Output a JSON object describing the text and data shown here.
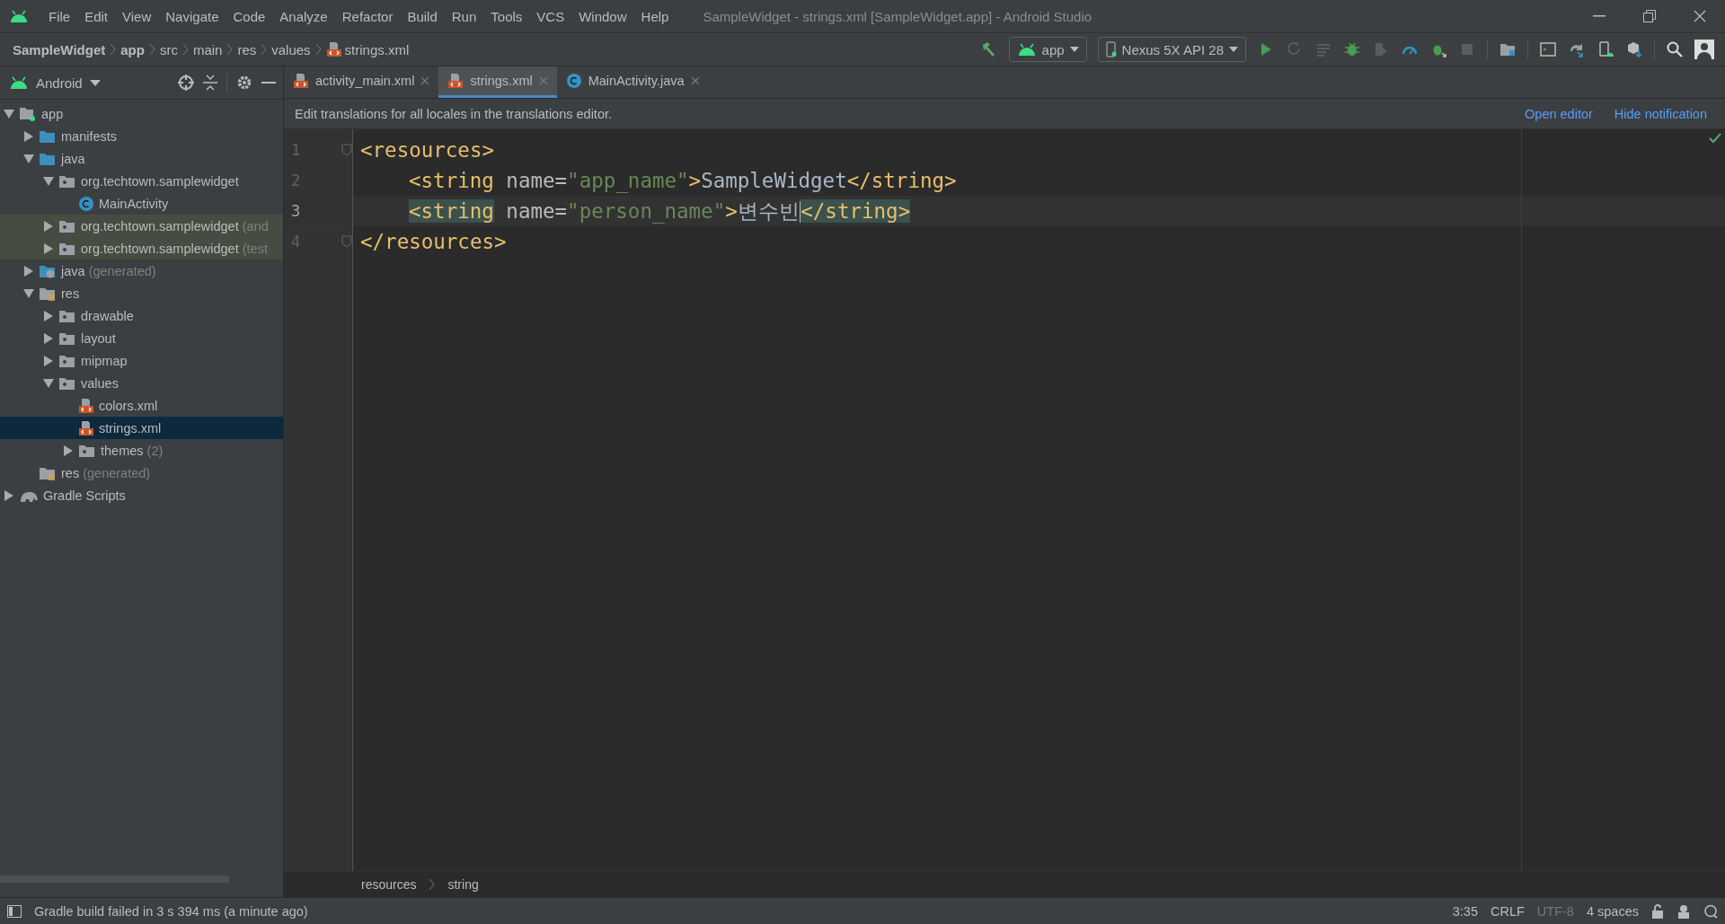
{
  "window": {
    "title": "SampleWidget - strings.xml [SampleWidget.app] - Android Studio"
  },
  "menu": [
    "File",
    "Edit",
    "View",
    "Navigate",
    "Code",
    "Analyze",
    "Refactor",
    "Build",
    "Run",
    "Tools",
    "VCS",
    "Window",
    "Help"
  ],
  "breadcrumb": [
    {
      "label": "SampleWidget",
      "kind": "project"
    },
    {
      "label": "app",
      "kind": "project"
    },
    {
      "label": "src",
      "kind": "folder"
    },
    {
      "label": "main",
      "kind": "folder"
    },
    {
      "label": "res",
      "kind": "folder"
    },
    {
      "label": "values",
      "kind": "folder"
    },
    {
      "label": "strings.xml",
      "kind": "file"
    }
  ],
  "toolbar": {
    "run_config": "app",
    "device": "Nexus 5X API 28"
  },
  "project_panel": {
    "view": "Android",
    "tree": [
      {
        "label": "app",
        "kind": "module",
        "expanded": true,
        "children": [
          {
            "label": "manifests",
            "kind": "folder",
            "expanded": false
          },
          {
            "label": "java",
            "kind": "folder",
            "expanded": true,
            "children": [
              {
                "label": "org.techtown.samplewidget",
                "kind": "package",
                "expanded": true,
                "children": [
                  {
                    "label": "MainActivity",
                    "kind": "class"
                  }
                ]
              },
              {
                "label": "org.techtown.samplewidget",
                "note": "(and",
                "kind": "package",
                "expanded": false,
                "tinted": true
              },
              {
                "label": "org.techtown.samplewidget",
                "note": "(test",
                "kind": "package",
                "expanded": false,
                "tinted": true
              }
            ]
          },
          {
            "label": "java",
            "note": "(generated)",
            "kind": "generated",
            "expanded": false
          },
          {
            "label": "res",
            "kind": "res",
            "expanded": true,
            "children": [
              {
                "label": "drawable",
                "kind": "package",
                "expanded": false
              },
              {
                "label": "layout",
                "kind": "package",
                "expanded": false
              },
              {
                "label": "mipmap",
                "kind": "package",
                "expanded": false
              },
              {
                "label": "values",
                "kind": "package",
                "expanded": true,
                "children": [
                  {
                    "label": "colors.xml",
                    "kind": "xml",
                    "selected": false
                  },
                  {
                    "label": "strings.xml",
                    "kind": "xml",
                    "selected": true
                  },
                  {
                    "label": "themes",
                    "note": "(2)",
                    "kind": "package",
                    "expanded": false
                  }
                ]
              }
            ]
          },
          {
            "label": "res",
            "note": "(generated)",
            "kind": "res"
          }
        ]
      },
      {
        "label": "Gradle Scripts",
        "kind": "gradle",
        "expanded": false
      }
    ]
  },
  "tabs": [
    {
      "label": "activity_main.xml",
      "kind": "xml",
      "selected": false
    },
    {
      "label": "strings.xml",
      "kind": "xml",
      "selected": true
    },
    {
      "label": "MainActivity.java",
      "kind": "class",
      "selected": false
    }
  ],
  "notification": {
    "text": "Edit translations for all locales in the translations editor.",
    "actions": [
      "Open editor",
      "Hide notification"
    ]
  },
  "editor": {
    "lines": [
      {
        "number": "1",
        "current": false,
        "fold": true,
        "indent": false,
        "tokens": [
          {
            "kind": "tag",
            "text": "<resources>"
          }
        ]
      },
      {
        "number": "2",
        "current": false,
        "fold": false,
        "indent": true,
        "tokens": [
          {
            "kind": "tag",
            "text": "<string"
          },
          {
            "kind": "attr",
            "text": " name="
          },
          {
            "kind": "value",
            "text": "\"app_name\""
          },
          {
            "kind": "tag",
            "text": ">"
          },
          {
            "kind": "text",
            "text": "SampleWidget"
          },
          {
            "kind": "tag",
            "text": "</string>"
          }
        ]
      },
      {
        "number": "3",
        "current": true,
        "fold": false,
        "indent": true,
        "tokens": [
          {
            "kind": "tag",
            "text": "<string",
            "matched": true
          },
          {
            "kind": "attr",
            "text": " name="
          },
          {
            "kind": "value",
            "text": "\"person_name\""
          },
          {
            "kind": "tag",
            "text": ">"
          },
          {
            "kind": "text",
            "text": "변수빈",
            "caret": true
          },
          {
            "kind": "tag",
            "text": "</string>",
            "matched": true
          }
        ]
      },
      {
        "number": "4",
        "current": false,
        "fold": true,
        "indent": false,
        "tokens": [
          {
            "kind": "tag",
            "text": "</resources>"
          }
        ]
      }
    ]
  },
  "footer_path": [
    "resources",
    "string"
  ],
  "status": {
    "message": "Gradle build failed in 3 s 394 ms (a minute ago)",
    "items": [
      {
        "text": "3:35",
        "disabled": false
      },
      {
        "text": "CRLF",
        "disabled": false
      },
      {
        "text": "UTF-8",
        "disabled": true
      },
      {
        "text": "4 spaces",
        "disabled": false
      }
    ]
  }
}
